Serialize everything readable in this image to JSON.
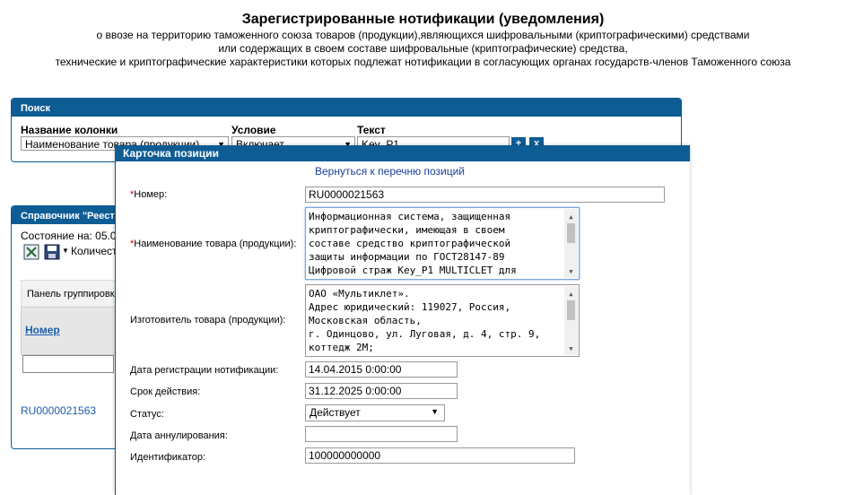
{
  "header": {
    "title": "Зарегистрированные нотификации (уведомления)",
    "lines": [
      "о ввозе на территорию таможенного союза товаров (продукции),являющихся шифровальными (криптографическими) средствами",
      "или содержащих в своем составе шифровальные (криптографические) средства,",
      "технические и криптографические характеристики которых подлежат нотификации в согласующих органах государств-членов Таможенного союза"
    ]
  },
  "search": {
    "title": "Поиск",
    "col_label": "Название колонки",
    "cond_label": "Условие",
    "text_label": "Текст",
    "column_value": "Наименование товара (продукции)",
    "condition_value": "Включает",
    "text_value": "Key_P1",
    "add": "+",
    "remove": "x"
  },
  "reference": {
    "title": "Справочник \"Реест",
    "state": "Состояние на: 05.0",
    "count": "Количест",
    "group_panel": "Панель группировки",
    "col_number": "Номер",
    "row_number": "RU0000021563"
  },
  "card": {
    "title": "Карточка позиции",
    "back": "Вернуться к перечню позиций",
    "number_label": "Номер:",
    "number": "RU0000021563",
    "name_label": "Наименование товара (продукции):",
    "name_lines": [
      "Информационная система, защищенная",
      "криптографически, имеющая в своем",
      "составе средство криптографической",
      "защиты информации по ГОСТ28147-89",
      "Цифровой страж Key_P1 MULTICLET для"
    ],
    "maker_label": "Изготовитель товара (продукции):",
    "maker_lines": [
      "ОАО «Мультиклет».",
      "Адрес юридический: 119027, Россия,",
      "Московская область,",
      "г. Одинцово, ул. Луговая, д. 4, стр. 9,",
      "коттедж 2М;"
    ],
    "reg_date_label": "Дата регистрации нотификации:",
    "reg_date": "14.04.2015 0:00:00",
    "valid_label": "Срок действия:",
    "valid": "31.12.2025 0:00:00",
    "status_label": "Статус:",
    "status": "Действует",
    "cancel_label": "Дата аннулирования:",
    "cancel": "",
    "id_label": "Идентификатор:",
    "id": "100000000000"
  }
}
